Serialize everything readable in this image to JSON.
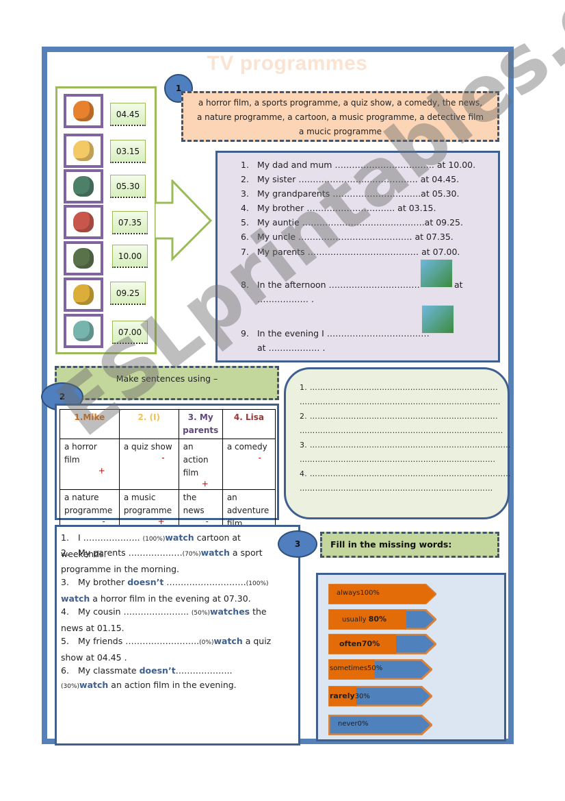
{
  "title": "TV programmes",
  "section1": {
    "number": "1",
    "word_bank": [
      "a horror film, a sports programme, a quiz show, a comedy, the news,",
      "a nature programme, a cartoon, a music programme, a detective film",
      "a mucic programme"
    ],
    "pictures": [
      {
        "icon": "cartoon-character-icon",
        "time": "04.45"
      },
      {
        "icon": "chef-cooking-icon",
        "time": "03.15"
      },
      {
        "icon": "detective-icon",
        "time": "05.30"
      },
      {
        "icon": "music-performer-icon",
        "time": "07.35"
      },
      {
        "icon": "horror-monster-icon",
        "time": "10.00"
      },
      {
        "icon": "quiz-show-icon",
        "time": "09.25"
      },
      {
        "icon": "news-reader-icon",
        "time": "07.00"
      }
    ],
    "sentences": [
      {
        "n": "1.",
        "text": "My dad and mum …………………………….. at 10.00."
      },
      {
        "n": "2.",
        "text": "My sister ……………………..……………. at 04.45."
      },
      {
        "n": "3.",
        "text": "My grandparents ………………………….at 05.30."
      },
      {
        "n": "4.",
        "text": "My brother …………………………. at 03.15."
      },
      {
        "n": "5.",
        "text": "My auntie …………………………………….at 09.25."
      },
      {
        "n": "6.",
        "text": "My uncle …………………………………. at 07.35."
      },
      {
        "n": "7.",
        "text": "My parents ………………………………… at 07.00."
      },
      {
        "n": "8.",
        "text": "In the afternoon ……………………………",
        "tail": "at",
        "line2": "……………… .",
        "icon": "lion-nature-icon"
      },
      {
        "n": "9.",
        "text": "In the evening I ………………………………",
        "line2": "at ……………… .",
        "icon": "tennis-player-icon"
      }
    ]
  },
  "section2": {
    "number": "2",
    "heading": "Make sentences using –",
    "columns": [
      {
        "label": "1.Mike",
        "color": "#e36c09"
      },
      {
        "label": "2. (I)",
        "color": "#f2c04c"
      },
      {
        "label": "3. My parents",
        "color": "#5f497a"
      },
      {
        "label": "4. Lisa",
        "color": "#953734"
      }
    ],
    "rows": [
      [
        {
          "text": "a horror film",
          "sign": "+"
        },
        {
          "text": "a quiz show",
          "sign": "-"
        },
        {
          "text": "an action film",
          "sign": "+"
        },
        {
          "text": "a comedy",
          "sign": "-"
        }
      ],
      [
        {
          "text": "a nature programme",
          "sign": "-"
        },
        {
          "text": "a music programme",
          "sign": "+"
        },
        {
          "text": "the news",
          "sign": "-"
        },
        {
          "text": "an adventure film",
          "sign": "+"
        }
      ]
    ],
    "answer_lines": [
      "1.  ……………………………………………………………….",
      "……………………………………………………………………",
      "2. ……………………………………………………………….",
      "…………………………………………………………………….",
      "3. ……………………………………………………………………",
      "………………………………………………………………….",
      "4. ……………………………………………………………………",
      "…………………………………………………………………"
    ]
  },
  "section3": {
    "number": "3",
    "heading": "Fill in the missing words:",
    "sentences": [
      {
        "n": "1.",
        "pre": "I ……………….. ",
        "pct": "(100%)",
        "verb": "watch",
        "post": " cartoon at weekends."
      },
      {
        "n": "2.",
        "pre": "My parents ……………….",
        "pct": "(70%)",
        "verb": "watch",
        "post": " a sport programme in the morning."
      },
      {
        "n": "3.",
        "pre": "My brother ",
        "neg": "doesn’t",
        "pre2": " ……………………….",
        "pct": "(100%)",
        "verb": " watch",
        "post": " a horror film in the evening at 07.30."
      },
      {
        "n": "4.",
        "pre": "My cousin ………………….. ",
        "pct": "(50%)",
        "verb": "watches",
        "post": " the news at 01.15."
      },
      {
        "n": "5.",
        "pre": "My friends  ……………………..",
        "pct": "(0%)",
        "verb": "watch",
        "post": "  a quiz show at 04.45 ."
      },
      {
        "n": "6.",
        "pre": "My classmate ",
        "neg": "doesn’t",
        "pre2": "……………….. ",
        "pct": "(30%)",
        "verb": "watch",
        "post": " an action film in the evening."
      }
    ],
    "scale": [
      {
        "word": "always",
        "pct_label": "100%",
        "value": 100
      },
      {
        "word": "usually",
        "pct_label": "80%",
        "value": 80
      },
      {
        "word": "often",
        "pct_label": "70%",
        "value": 70
      },
      {
        "word": "sometimes",
        "pct_label": "50%",
        "value": 50
      },
      {
        "word": "rarely",
        "pct_label": "30%",
        "value": 30
      },
      {
        "word": "never",
        "pct_label": "0%",
        "value": 0
      }
    ],
    "colors": {
      "filled": "#e36c09",
      "empty": "#4f81bd",
      "border": "#d9823a"
    }
  },
  "watermark": "ESLprintables.com"
}
